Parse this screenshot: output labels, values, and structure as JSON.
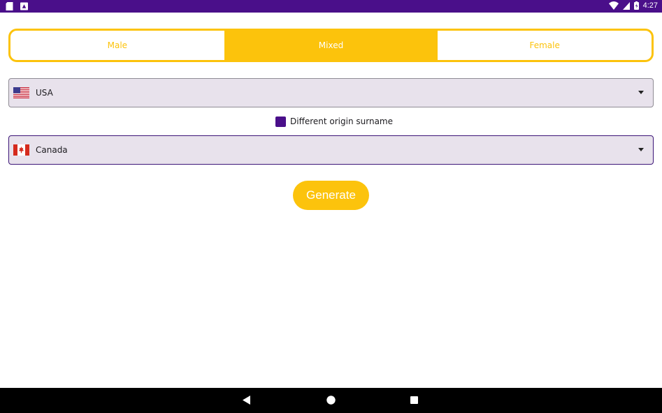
{
  "status_bar": {
    "time": "4:27",
    "icons": [
      "sd-card-icon",
      "notification-icon",
      "wifi-icon",
      "cell-signal-icon",
      "battery-icon"
    ]
  },
  "gender_selector": {
    "tabs": [
      {
        "label": "Male",
        "selected": false
      },
      {
        "label": "Mixed",
        "selected": true
      },
      {
        "label": "Female",
        "selected": false
      }
    ]
  },
  "origin_dropdown": {
    "flag": "usa-flag-icon",
    "value": "USA"
  },
  "surname_option": {
    "label": "Different origin surname",
    "checked": true
  },
  "surname_dropdown": {
    "flag": "canada-flag-icon",
    "value": "Canada"
  },
  "generate_button": {
    "label": "Generate"
  },
  "nav_bar": {
    "icons": [
      "back-icon",
      "home-icon",
      "recents-icon"
    ]
  },
  "colors": {
    "primary": "#4a0f8a",
    "accent": "#fcc30c",
    "field_background": "#e8e2ec"
  }
}
